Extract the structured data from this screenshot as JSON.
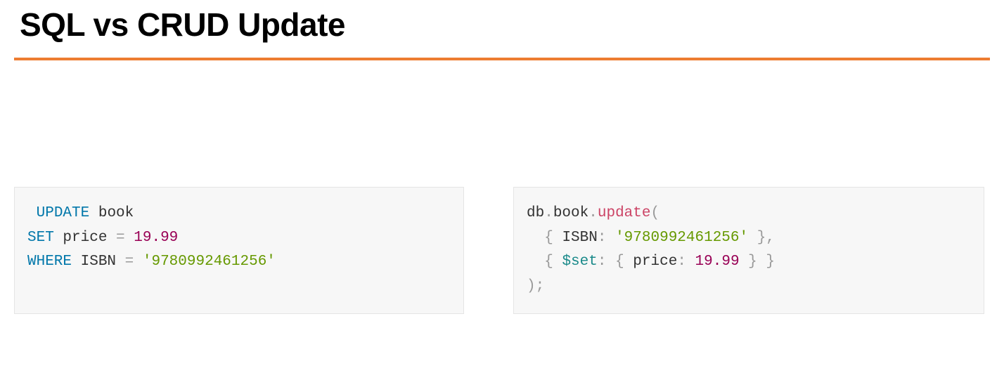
{
  "title": "SQL vs CRUD Update",
  "sql": {
    "kw_update": "UPDATE",
    "table": "book",
    "kw_set": "SET",
    "field_price": "price",
    "eq1": "=",
    "price_val": "19.99",
    "kw_where": "WHERE",
    "field_isbn": "ISBN",
    "eq2": "=",
    "isbn_val": "'9780992461256'"
  },
  "crud": {
    "db": "db",
    "dot1": ".",
    "book": "book",
    "dot2": ".",
    "update": "update",
    "open": "(",
    "brace_o1": "{",
    "isbn_key": "ISBN",
    "colon1": ":",
    "isbn_val": "'9780992461256'",
    "brace_c1": "}",
    "comma1": ",",
    "brace_o2": "{",
    "set_key": "$set",
    "colon2": ":",
    "brace_o3": "{",
    "price_key": "price",
    "colon3": ":",
    "price_val": "19.99",
    "brace_c3": "}",
    "brace_c2": "}",
    "close": ")",
    "semi": ";"
  }
}
